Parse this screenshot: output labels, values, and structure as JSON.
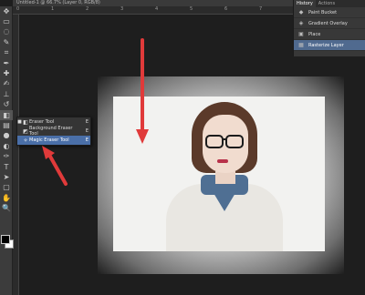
{
  "document_tab": "Untitled-1 @ 66.7% (Layer 0, RGB/8)",
  "ruler_ticks": [
    "0",
    "1",
    "2",
    "3",
    "4",
    "5",
    "6",
    "7",
    "8",
    "9"
  ],
  "toolbar": {
    "tools": [
      {
        "icon": "move-icon",
        "glyph": "✥"
      },
      {
        "icon": "marquee-icon",
        "glyph": "▭"
      },
      {
        "icon": "lasso-icon",
        "glyph": "◌"
      },
      {
        "icon": "quick-select-icon",
        "glyph": "✎"
      },
      {
        "icon": "crop-icon",
        "glyph": "⌗"
      },
      {
        "icon": "eyedropper-icon",
        "glyph": "✒"
      },
      {
        "icon": "healing-brush-icon",
        "glyph": "✚"
      },
      {
        "icon": "brush-icon",
        "glyph": "✍"
      },
      {
        "icon": "clone-stamp-icon",
        "glyph": "⊥"
      },
      {
        "icon": "history-brush-icon",
        "glyph": "↺"
      },
      {
        "icon": "eraser-icon",
        "glyph": "◧"
      },
      {
        "icon": "gradient-icon",
        "glyph": "▤"
      },
      {
        "icon": "blur-icon",
        "glyph": "●"
      },
      {
        "icon": "dodge-icon",
        "glyph": "◐"
      },
      {
        "icon": "pen-icon",
        "glyph": "✑"
      },
      {
        "icon": "type-icon",
        "glyph": "T"
      },
      {
        "icon": "path-select-icon",
        "glyph": "➤"
      },
      {
        "icon": "shape-icon",
        "glyph": "▢"
      },
      {
        "icon": "hand-icon",
        "glyph": "✋"
      },
      {
        "icon": "zoom-icon",
        "glyph": "🔍"
      }
    ],
    "active_tool": "eraser-icon"
  },
  "flyout": {
    "items": [
      {
        "label": "Eraser Tool",
        "shortcut": "E",
        "icon": "eraser-icon",
        "glyph": "◧",
        "selected": false,
        "current": true
      },
      {
        "label": "Background Eraser Tool",
        "shortcut": "E",
        "icon": "background-eraser-icon",
        "glyph": "◩",
        "selected": false,
        "current": false
      },
      {
        "label": "Magic Eraser Tool",
        "shortcut": "E",
        "icon": "magic-eraser-icon",
        "glyph": "✧",
        "selected": true,
        "current": false
      }
    ]
  },
  "history": {
    "tabs": [
      "History",
      "Actions"
    ],
    "active_tab": "History",
    "rows": [
      {
        "label": "Paint Bucket",
        "icon": "paint-bucket-icon",
        "glyph": "◆",
        "selected": false
      },
      {
        "label": "Gradient Overlay",
        "icon": "layer-style-icon",
        "glyph": "◈",
        "selected": false
      },
      {
        "label": "Place",
        "icon": "place-icon",
        "glyph": "▣",
        "selected": false
      },
      {
        "label": "Rasterize Layer",
        "icon": "rasterize-icon",
        "glyph": "▦",
        "selected": true
      }
    ]
  },
  "colors": {
    "annotation_arrow": "#e03a3a",
    "selection": "#4a6fa8",
    "history_selection": "#506a8f",
    "foreground": "#000000",
    "background": "#ffffff"
  }
}
